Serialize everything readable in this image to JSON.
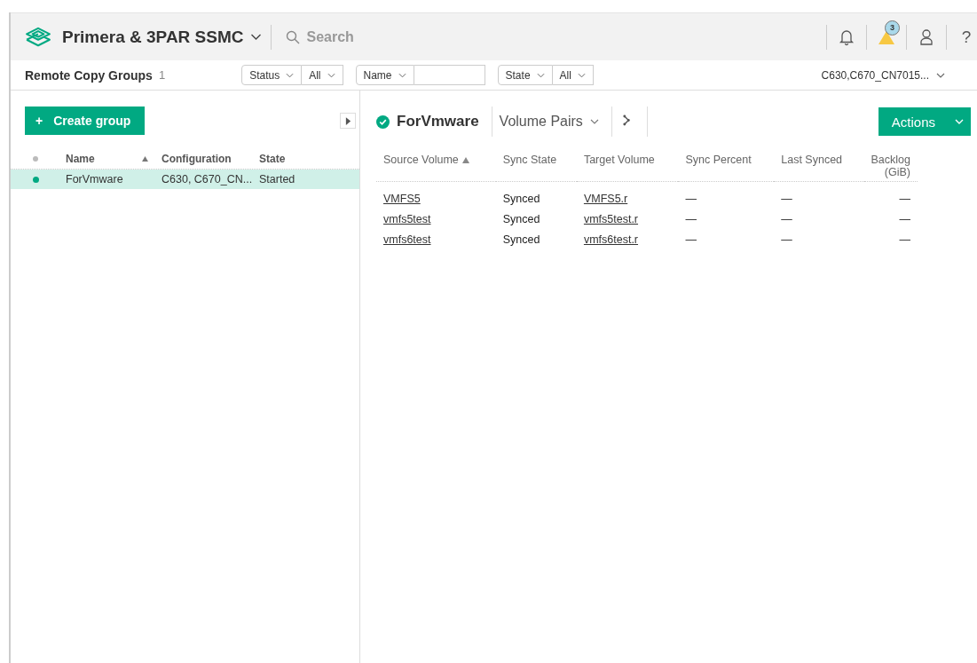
{
  "header": {
    "app_title": "Primera & 3PAR SSMC",
    "search": {
      "placeholder": "Search"
    },
    "alert_count": "3",
    "help": "?"
  },
  "toolbar": {
    "title": "Remote Copy Groups",
    "count": "1",
    "filters": [
      {
        "label": "Status",
        "value": "All",
        "kind": "select"
      },
      {
        "label": "Name",
        "kind": "text"
      },
      {
        "label": "State",
        "value": "All",
        "kind": "select"
      }
    ],
    "system": "C630,C670_CN7015..."
  },
  "left_panel": {
    "create_button": "Create group",
    "plus": "+",
    "columns": [
      {
        "label": "Name",
        "sorted": true
      },
      {
        "label": "Configuration",
        "sorted": false
      },
      {
        "label": "State",
        "sorted": false
      }
    ],
    "rows": [
      {
        "name": "ForVmware",
        "configuration": "C630, C670_CN...",
        "state": "Started",
        "selected": true,
        "color": "#01a982"
      }
    ]
  },
  "detail": {
    "title": "ForVmware",
    "status_ok": true,
    "view": "Volume Pairs",
    "actions": "Actions",
    "columns": [
      {
        "label": "Source Volume",
        "sorted": true
      },
      {
        "label": "Sync State",
        "sorted": false
      },
      {
        "label": "Target Volume",
        "sorted": false
      },
      {
        "label": "Sync Percent",
        "sorted": false
      },
      {
        "label": "Last Synced",
        "sorted": false
      },
      {
        "label": "Backlog (GiB)",
        "sorted": false
      }
    ],
    "rows": [
      {
        "source": "VMFS5",
        "sync_state": "Synced",
        "target": "VMFS5.r",
        "sync_percent": "—",
        "last_synced": "—",
        "backlog": "—"
      },
      {
        "source": "vmfs5test",
        "sync_state": "Synced",
        "target": "vmfs5test.r",
        "sync_percent": "—",
        "last_synced": "—",
        "backlog": "—"
      },
      {
        "source": "vmfs6test",
        "sync_state": "Synced",
        "target": "vmfs6test.r",
        "sync_percent": "—",
        "last_synced": "—",
        "backlog": "—"
      }
    ]
  }
}
